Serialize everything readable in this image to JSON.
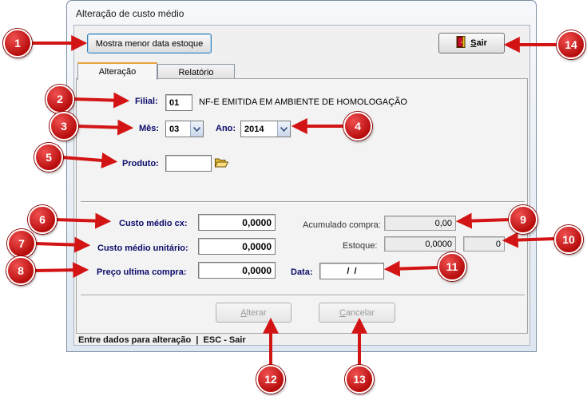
{
  "window": {
    "title": "Alteração de custo médio"
  },
  "toolbar": {
    "menor_data_label": "Mostra menor data estoque",
    "sair_label": "Sair",
    "sair_mnemonic": "S",
    "sair_rest": "air"
  },
  "tabs": [
    {
      "label": "Alteração",
      "active": true
    },
    {
      "label": "Relatório",
      "active": false
    }
  ],
  "form": {
    "filial": {
      "label": "Filial:",
      "value": "01",
      "description": "NF-E EMITIDA EM AMBIENTE DE HOMOLOGAÇÃO"
    },
    "mes": {
      "label": "Mês:",
      "value": "03"
    },
    "ano": {
      "label": "Ano:",
      "value": "2014"
    },
    "produto": {
      "label": "Produto:",
      "value": ""
    },
    "custo_medio_cx": {
      "label": "Custo médio cx:",
      "value": "0,0000"
    },
    "custo_medio_unitario": {
      "label": "Custo médio unitário:",
      "value": "0,0000"
    },
    "preco_ultima_compra": {
      "label": "Preço ultima compra:",
      "value": "0,0000"
    },
    "acumulado_compra": {
      "label": "Acumulado compra:",
      "value": "0,00"
    },
    "estoque": {
      "label": "Estoque:",
      "value": "0,0000",
      "value2": "0"
    },
    "data": {
      "label": "Data:",
      "value": " /  / "
    }
  },
  "actions": {
    "alterar": {
      "label": "Alterar",
      "mnemonic": "A",
      "rest": "lterar"
    },
    "cancelar": {
      "label": "Cancelar",
      "mnemonic": "C",
      "rest": "ancelar"
    }
  },
  "status": {
    "text": "Entre dados para alteração  |  ESC - Sair"
  },
  "callouts": [
    "1",
    "2",
    "3",
    "4",
    "5",
    "6",
    "7",
    "8",
    "9",
    "10",
    "11",
    "12",
    "13",
    "14"
  ],
  "colors": {
    "callout": "#c81414",
    "label": "#0b0b6a",
    "tab_accent": "#e8a43a"
  }
}
